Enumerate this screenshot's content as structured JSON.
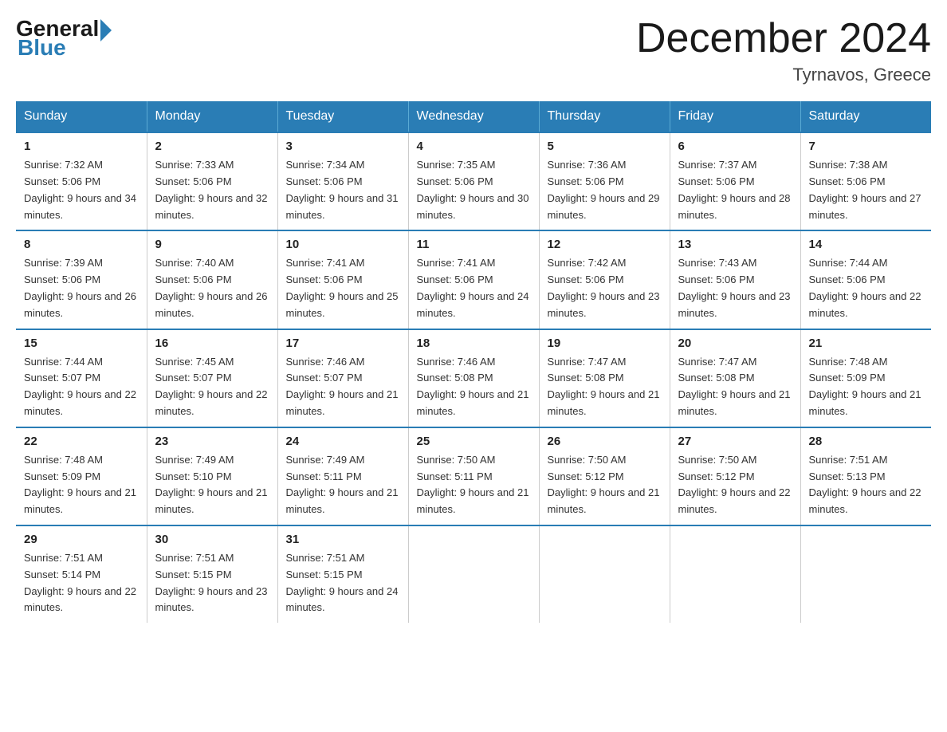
{
  "header": {
    "logo": {
      "general": "General",
      "blue": "Blue"
    },
    "title": "December 2024",
    "location": "Tyrnavos, Greece"
  },
  "weekdays": [
    "Sunday",
    "Monday",
    "Tuesday",
    "Wednesday",
    "Thursday",
    "Friday",
    "Saturday"
  ],
  "weeks": [
    [
      {
        "day": "1",
        "sunrise": "7:32 AM",
        "sunset": "5:06 PM",
        "daylight": "9 hours and 34 minutes."
      },
      {
        "day": "2",
        "sunrise": "7:33 AM",
        "sunset": "5:06 PM",
        "daylight": "9 hours and 32 minutes."
      },
      {
        "day": "3",
        "sunrise": "7:34 AM",
        "sunset": "5:06 PM",
        "daylight": "9 hours and 31 minutes."
      },
      {
        "day": "4",
        "sunrise": "7:35 AM",
        "sunset": "5:06 PM",
        "daylight": "9 hours and 30 minutes."
      },
      {
        "day": "5",
        "sunrise": "7:36 AM",
        "sunset": "5:06 PM",
        "daylight": "9 hours and 29 minutes."
      },
      {
        "day": "6",
        "sunrise": "7:37 AM",
        "sunset": "5:06 PM",
        "daylight": "9 hours and 28 minutes."
      },
      {
        "day": "7",
        "sunrise": "7:38 AM",
        "sunset": "5:06 PM",
        "daylight": "9 hours and 27 minutes."
      }
    ],
    [
      {
        "day": "8",
        "sunrise": "7:39 AM",
        "sunset": "5:06 PM",
        "daylight": "9 hours and 26 minutes."
      },
      {
        "day": "9",
        "sunrise": "7:40 AM",
        "sunset": "5:06 PM",
        "daylight": "9 hours and 26 minutes."
      },
      {
        "day": "10",
        "sunrise": "7:41 AM",
        "sunset": "5:06 PM",
        "daylight": "9 hours and 25 minutes."
      },
      {
        "day": "11",
        "sunrise": "7:41 AM",
        "sunset": "5:06 PM",
        "daylight": "9 hours and 24 minutes."
      },
      {
        "day": "12",
        "sunrise": "7:42 AM",
        "sunset": "5:06 PM",
        "daylight": "9 hours and 23 minutes."
      },
      {
        "day": "13",
        "sunrise": "7:43 AM",
        "sunset": "5:06 PM",
        "daylight": "9 hours and 23 minutes."
      },
      {
        "day": "14",
        "sunrise": "7:44 AM",
        "sunset": "5:06 PM",
        "daylight": "9 hours and 22 minutes."
      }
    ],
    [
      {
        "day": "15",
        "sunrise": "7:44 AM",
        "sunset": "5:07 PM",
        "daylight": "9 hours and 22 minutes."
      },
      {
        "day": "16",
        "sunrise": "7:45 AM",
        "sunset": "5:07 PM",
        "daylight": "9 hours and 22 minutes."
      },
      {
        "day": "17",
        "sunrise": "7:46 AM",
        "sunset": "5:07 PM",
        "daylight": "9 hours and 21 minutes."
      },
      {
        "day": "18",
        "sunrise": "7:46 AM",
        "sunset": "5:08 PM",
        "daylight": "9 hours and 21 minutes."
      },
      {
        "day": "19",
        "sunrise": "7:47 AM",
        "sunset": "5:08 PM",
        "daylight": "9 hours and 21 minutes."
      },
      {
        "day": "20",
        "sunrise": "7:47 AM",
        "sunset": "5:08 PM",
        "daylight": "9 hours and 21 minutes."
      },
      {
        "day": "21",
        "sunrise": "7:48 AM",
        "sunset": "5:09 PM",
        "daylight": "9 hours and 21 minutes."
      }
    ],
    [
      {
        "day": "22",
        "sunrise": "7:48 AM",
        "sunset": "5:09 PM",
        "daylight": "9 hours and 21 minutes."
      },
      {
        "day": "23",
        "sunrise": "7:49 AM",
        "sunset": "5:10 PM",
        "daylight": "9 hours and 21 minutes."
      },
      {
        "day": "24",
        "sunrise": "7:49 AM",
        "sunset": "5:11 PM",
        "daylight": "9 hours and 21 minutes."
      },
      {
        "day": "25",
        "sunrise": "7:50 AM",
        "sunset": "5:11 PM",
        "daylight": "9 hours and 21 minutes."
      },
      {
        "day": "26",
        "sunrise": "7:50 AM",
        "sunset": "5:12 PM",
        "daylight": "9 hours and 21 minutes."
      },
      {
        "day": "27",
        "sunrise": "7:50 AM",
        "sunset": "5:12 PM",
        "daylight": "9 hours and 22 minutes."
      },
      {
        "day": "28",
        "sunrise": "7:51 AM",
        "sunset": "5:13 PM",
        "daylight": "9 hours and 22 minutes."
      }
    ],
    [
      {
        "day": "29",
        "sunrise": "7:51 AM",
        "sunset": "5:14 PM",
        "daylight": "9 hours and 22 minutes."
      },
      {
        "day": "30",
        "sunrise": "7:51 AM",
        "sunset": "5:15 PM",
        "daylight": "9 hours and 23 minutes."
      },
      {
        "day": "31",
        "sunrise": "7:51 AM",
        "sunset": "5:15 PM",
        "daylight": "9 hours and 24 minutes."
      },
      null,
      null,
      null,
      null
    ]
  ]
}
